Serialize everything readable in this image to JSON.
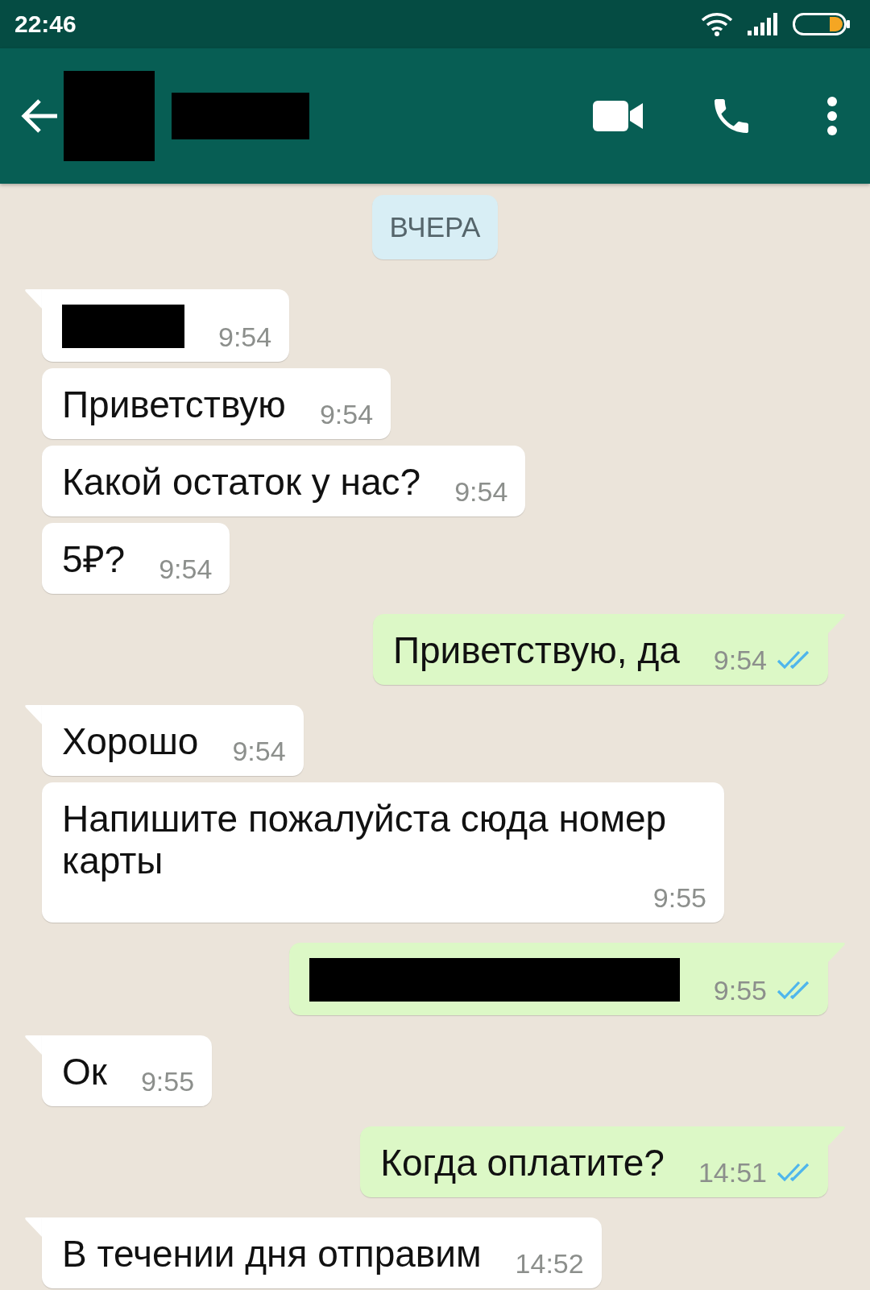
{
  "status_bar": {
    "time": "22:46"
  },
  "header": {
    "avatar_redacted": true,
    "name_redacted": true
  },
  "date_chip": "ВЧЕРА",
  "messages": [
    {
      "outgoing": false,
      "kind": "redacted",
      "wide": false,
      "time": "9:54"
    },
    {
      "outgoing": false,
      "kind": "text",
      "text": "Приветствую",
      "time": "9:54"
    },
    {
      "outgoing": false,
      "kind": "text",
      "text": "Какой остаток у нас?",
      "time": "9:54"
    },
    {
      "outgoing": false,
      "kind": "text",
      "text": "5₽?",
      "time": "9:54"
    },
    {
      "outgoing": true,
      "kind": "text",
      "text": "Приветствую, да",
      "time": "9:54",
      "read": true
    },
    {
      "outgoing": false,
      "kind": "text",
      "text": "Хорошо",
      "time": "9:54"
    },
    {
      "outgoing": false,
      "kind": "text",
      "text": "Напишите пожалуйста сюда номер карты",
      "time": "9:55"
    },
    {
      "outgoing": true,
      "kind": "redacted",
      "wide": true,
      "time": "9:55",
      "read": true
    },
    {
      "outgoing": false,
      "kind": "text",
      "text": "Ок",
      "time": "9:55"
    },
    {
      "outgoing": true,
      "kind": "text",
      "text": "Когда оплатите?",
      "time": "14:51",
      "read": true
    },
    {
      "outgoing": false,
      "kind": "text",
      "text": "В течении дня отправим",
      "time": "14:52"
    }
  ]
}
